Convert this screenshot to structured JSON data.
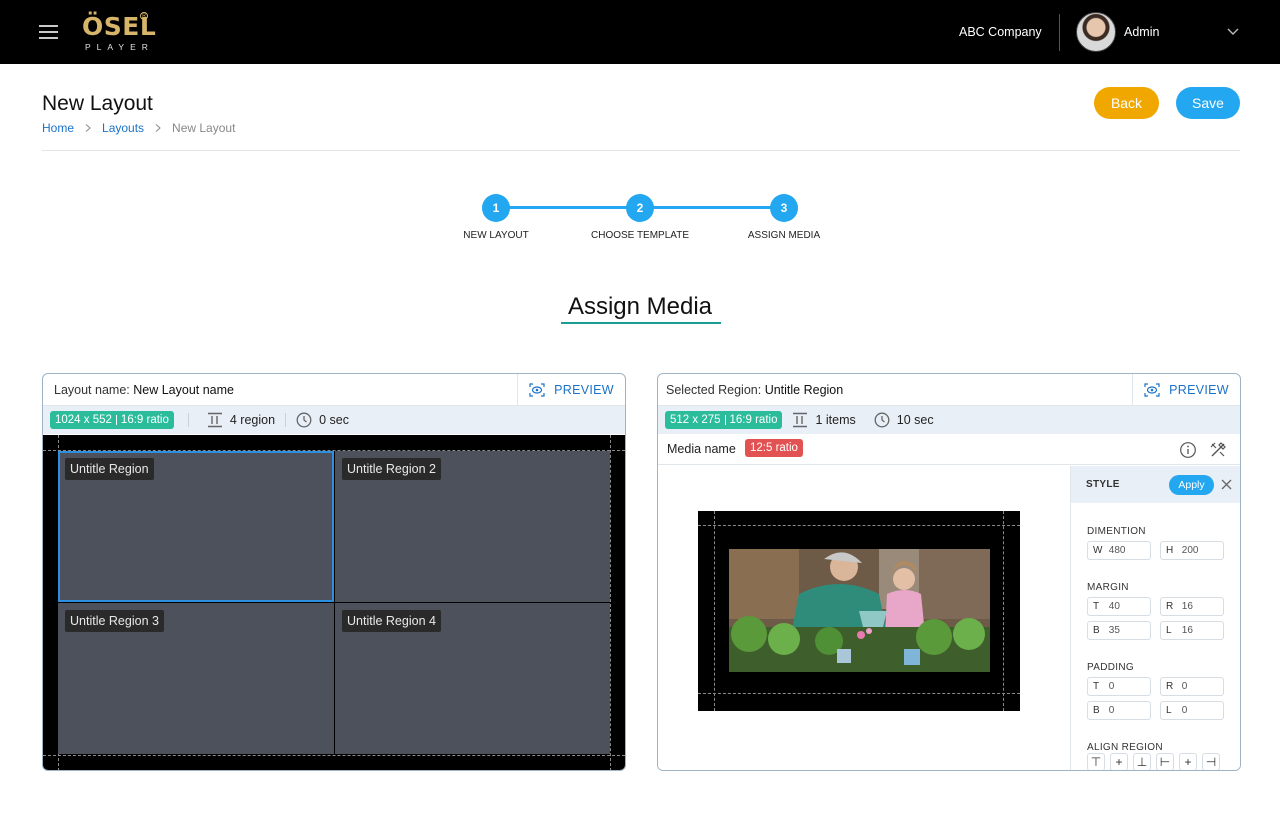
{
  "topbar": {
    "logo_main": "ÖSEL",
    "logo_sub": "PLAYER",
    "logo_reg": "R",
    "company": "ABC Company",
    "user_name": "Admin"
  },
  "page": {
    "title": "New Layout",
    "breadcrumb": [
      "Home",
      "Layouts",
      "New Layout"
    ],
    "back_label": "Back",
    "save_label": "Save"
  },
  "stepper": {
    "steps": [
      {
        "number": "1",
        "label": "NEW LAYOUT"
      },
      {
        "number": "2",
        "label": "CHOOSE TEMPLATE"
      },
      {
        "number": "3",
        "label": "ASSIGN MEDIA"
      }
    ],
    "current_step": 3
  },
  "section_title": "Assign Media",
  "left_panel": {
    "layout_name_label": "Layout name:",
    "layout_name": "New Layout name",
    "preview_label": "PREVIEW",
    "resolution": "1024 x 552",
    "ratio": "16:9 ratio",
    "region_count": "4 region",
    "duration": "0 sec",
    "regions": [
      {
        "label": "Untitle Region",
        "selected": true
      },
      {
        "label": "Untitle Region 2",
        "selected": false
      },
      {
        "label": "Untitle Region 3",
        "selected": false
      },
      {
        "label": "Untitle Region 4",
        "selected": false
      }
    ]
  },
  "right_panel": {
    "selected_region_label": "Selected Region:",
    "selected_region": "Untitle Region",
    "preview_label": "PREVIEW",
    "resolution": "512 x 275",
    "ratio": "16:9 ratio",
    "items_count": "1 items",
    "duration": "10 sec",
    "media_name_label": "Media name",
    "media_ratio": "12:5 ratio"
  },
  "style_panel": {
    "title": "STYLE",
    "apply_label": "Apply",
    "dimension_label": "DIMENTION",
    "dimension": {
      "W": "480",
      "H": "200"
    },
    "margin_label": "MARGIN",
    "margin": {
      "T": "40",
      "R": "16",
      "B": "35",
      "L": "16"
    },
    "padding_label": "PADDING",
    "padding": {
      "T": "0",
      "R": "0",
      "B": "0",
      "L": "0"
    },
    "align_label": "ALIGN REGION",
    "align_icons": [
      "align-top-icon",
      "align-center-vertical-icon",
      "align-bottom-icon",
      "align-left-icon",
      "align-center-horizontal-icon",
      "align-right-icon"
    ]
  },
  "colors": {
    "accent": "#22a7f0",
    "back_button": "#f0a800",
    "tag_green": "#2bbd9b",
    "tag_red": "#e35252",
    "region_fill": "#4c515b",
    "selected_outline": "#2c8fe0"
  }
}
